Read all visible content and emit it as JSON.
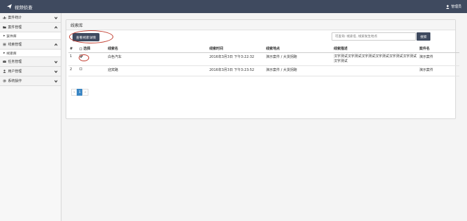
{
  "app": {
    "title": "视频侦查",
    "user": "管理员"
  },
  "sidebar": {
    "items": [
      {
        "label": "案件统计",
        "icon": "bar-chart-icon",
        "expanded": false
      },
      {
        "label": "案件管理",
        "icon": "folder-icon",
        "expanded": true,
        "sub": "案件库"
      },
      {
        "label": "线索管理",
        "icon": "list-icon",
        "expanded": true,
        "sub": "线索库"
      },
      {
        "label": "任务管理",
        "icon": "envelope-icon",
        "expanded": false
      },
      {
        "label": "用户管理",
        "icon": "user-icon",
        "expanded": false
      },
      {
        "label": "系统操作",
        "icon": "gear-icon",
        "expanded": false
      }
    ]
  },
  "panel": {
    "title": "线索库",
    "detail_button": "查看线索详情",
    "search_placeholder": "可查询: 线索名, 线索发生地点",
    "search_button": "搜索"
  },
  "table": {
    "headers": {
      "num": "#",
      "select": "选择",
      "name": "线索名",
      "time": "线索时间",
      "place": "线索地点",
      "desc": "线索描述",
      "case": "案件名"
    },
    "rows": [
      {
        "num": "1",
        "checked": true,
        "name": "白色汽车",
        "time": "2016年3月3日 下午3:22:32",
        "place": "演示案件 / 大货拐跑",
        "desc": "汉字测试汉字测试汉字测试汉字测试汉字测试汉字测试汉字测试",
        "case": "演示案件"
      },
      {
        "num": "2",
        "checked": false,
        "name": "迎宾路",
        "time": "2016年3月3日 下午3:23:52",
        "place": "演示案件 / 大货拐跑",
        "desc": "",
        "case": "演示案件"
      }
    ]
  },
  "pager": {
    "prev": "«",
    "page": "1",
    "next": "»"
  },
  "colors": {
    "header_bg": "#3f4a5f",
    "highlight": "#c0392b",
    "active_page": "#3a86c4"
  }
}
